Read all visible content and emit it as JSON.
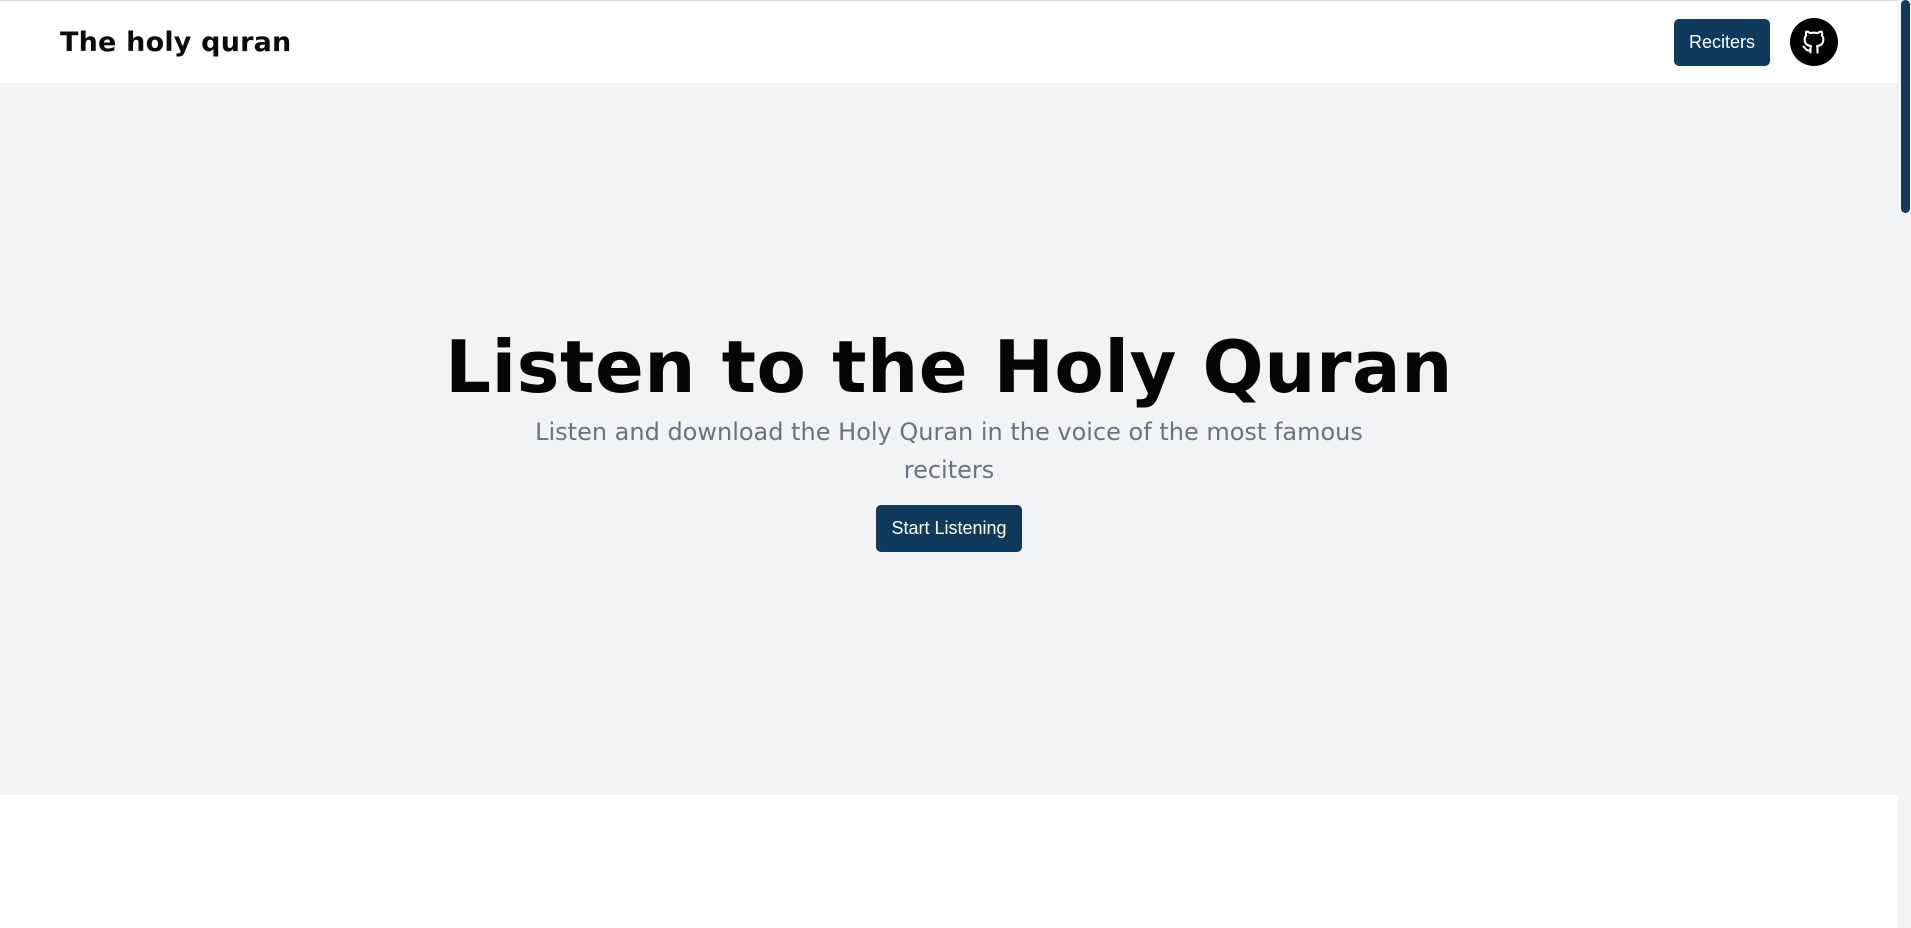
{
  "navbar": {
    "brand": "The holy quran",
    "reciters_label": "Reciters",
    "github_icon": "github-icon"
  },
  "hero": {
    "title": "Listen to the Holy Quran",
    "subtitle": "Listen and download the Holy Quran in the voice of the most famous reciters",
    "cta_label": "Start Listening"
  },
  "colors": {
    "accent": "#0f3a5c",
    "hero_bg": "#f2f3f5",
    "subtitle_text": "#6b7280"
  }
}
